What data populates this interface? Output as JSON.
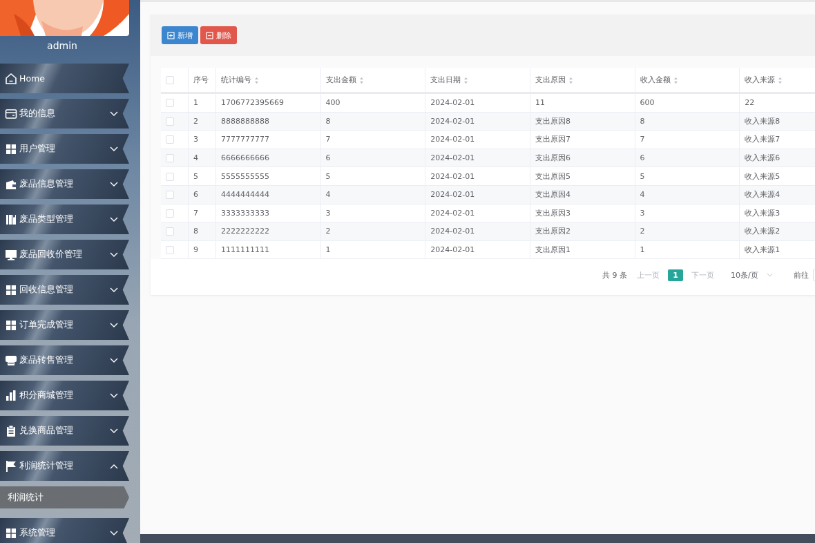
{
  "sidebar": {
    "username": "admin",
    "items": [
      {
        "label": "Home",
        "kind": "link"
      },
      {
        "label": "我的信息",
        "kind": "menu",
        "expanded": false
      },
      {
        "label": "用户管理",
        "kind": "menu",
        "expanded": false
      },
      {
        "label": "废品信息管理",
        "kind": "menu",
        "expanded": false
      },
      {
        "label": "废品类型管理",
        "kind": "menu",
        "expanded": false
      },
      {
        "label": "废品回收价管理",
        "kind": "menu",
        "expanded": false
      },
      {
        "label": "回收信息管理",
        "kind": "menu",
        "expanded": false
      },
      {
        "label": "订单完成管理",
        "kind": "menu",
        "expanded": false
      },
      {
        "label": "废品转售管理",
        "kind": "menu",
        "expanded": false
      },
      {
        "label": "积分商城管理",
        "kind": "menu",
        "expanded": false
      },
      {
        "label": "兑换商品管理",
        "kind": "menu",
        "expanded": false
      },
      {
        "label": "利润统计管理",
        "kind": "menu",
        "expanded": true,
        "children": [
          {
            "label": "利润统计",
            "selected": true
          }
        ]
      },
      {
        "label": "系统管理",
        "kind": "menu",
        "expanded": false
      }
    ]
  },
  "toolbar": {
    "buttons": [
      {
        "label": "新增",
        "kind": "add"
      },
      {
        "label": "删除",
        "kind": "delete"
      }
    ]
  },
  "table": {
    "select_all": {
      "checked": false
    },
    "columns": [
      {
        "label": "序号",
        "sortable": false
      },
      {
        "label": "统计编号",
        "sortable": true
      },
      {
        "label": "支出金额",
        "sortable": true
      },
      {
        "label": "支出日期",
        "sortable": true
      },
      {
        "label": "支出原因",
        "sortable": true
      },
      {
        "label": "收入金额",
        "sortable": true
      },
      {
        "label": "收入来源",
        "sortable": true
      }
    ],
    "rows": [
      {
        "checked": false,
        "cells": [
          "1",
          "1706772395669",
          "400",
          "2024-02-01",
          "11",
          "600",
          "22"
        ]
      },
      {
        "checked": false,
        "cells": [
          "2",
          "8888888888",
          "8",
          "2024-02-01",
          "支出原因8",
          "8",
          "收入来源8"
        ]
      },
      {
        "checked": false,
        "cells": [
          "3",
          "7777777777",
          "7",
          "2024-02-01",
          "支出原因7",
          "7",
          "收入来源7"
        ]
      },
      {
        "checked": false,
        "cells": [
          "4",
          "6666666666",
          "6",
          "2024-02-01",
          "支出原因6",
          "6",
          "收入来源6"
        ]
      },
      {
        "checked": false,
        "cells": [
          "5",
          "5555555555",
          "5",
          "2024-02-01",
          "支出原因5",
          "5",
          "收入来源5"
        ]
      },
      {
        "checked": false,
        "cells": [
          "6",
          "4444444444",
          "4",
          "2024-02-01",
          "支出原因4",
          "4",
          "收入来源4"
        ]
      },
      {
        "checked": false,
        "cells": [
          "7",
          "3333333333",
          "3",
          "2024-02-01",
          "支出原因3",
          "3",
          "收入来源3"
        ]
      },
      {
        "checked": false,
        "cells": [
          "8",
          "2222222222",
          "2",
          "2024-02-01",
          "支出原因2",
          "2",
          "收入来源2"
        ]
      },
      {
        "checked": false,
        "cells": [
          "9",
          "1111111111",
          "1",
          "2024-02-01",
          "支出原因1",
          "1",
          "收入来源1"
        ]
      }
    ]
  },
  "pagination": {
    "total": "共 9 条",
    "prev": {
      "label": "上一页",
      "disabled": true
    },
    "pages": [
      {
        "label": "1",
        "selected": true
      }
    ],
    "next": {
      "label": "下一页",
      "disabled": true
    },
    "page_size": "10条/页",
    "goto": "前往"
  }
}
